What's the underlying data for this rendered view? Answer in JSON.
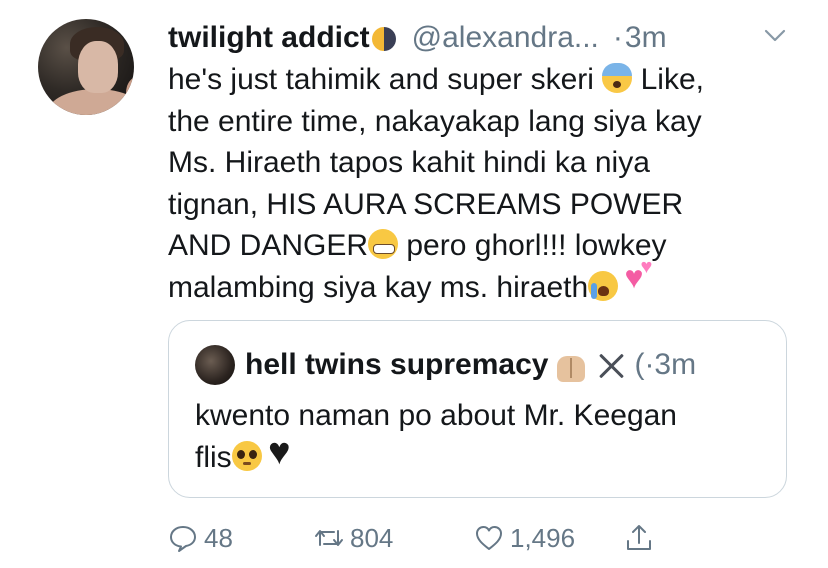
{
  "tweet": {
    "display_name": "twilight addict",
    "handle": "@alexandra...",
    "separator": "·",
    "time": "3m",
    "text_lines": [
      "he's just tahimik and super skeri",
      "Like,",
      "the entire time, nakayakap lang siya kay",
      "Ms. Hiraeth tapos kahit hindi ka niya",
      "tignan, HIS AURA SCREAMS POWER",
      "AND DANGER",
      "pero ghorl!!! lowkey",
      "malambing siya kay ms. hiraeth"
    ]
  },
  "quoted_tweet": {
    "display_name": "hell twins supremacy",
    "meta": "(·3m",
    "text_lines": [
      "kwento naman po about Mr. Keegan",
      "flis"
    ]
  },
  "actions": {
    "reply_count": "48",
    "retweet_count": "804",
    "like_count": "1,496"
  },
  "icons": {
    "header": [
      "moon-icon",
      "chevron-down-icon"
    ],
    "text": [
      "fearful-face-icon",
      "grimacing-face-icon",
      "sob-face-icon",
      "two-hearts-icon"
    ],
    "quote": [
      "raised-hands-icon",
      "crossed-swords-icon",
      "pleading-face-icon",
      "black-heart-icon"
    ],
    "actions": [
      "reply-icon",
      "retweet-icon",
      "like-icon",
      "share-icon"
    ]
  },
  "colors": {
    "text": "#14171a",
    "secondary": "#657786",
    "border": "#ccd6dd"
  }
}
